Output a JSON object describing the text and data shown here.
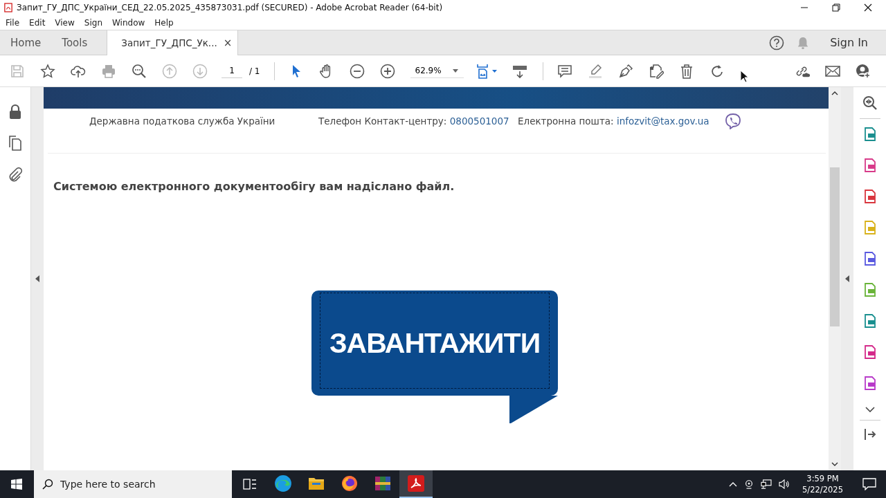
{
  "window": {
    "title": "Запит_ГУ_ДПС_України_СЕД_22.05.2025_435873031.pdf (SECURED) - Adobe Acrobat Reader (64-bit)"
  },
  "menu": [
    "File",
    "Edit",
    "View",
    "Sign",
    "Window",
    "Help"
  ],
  "tabs": [
    {
      "label": "Home",
      "selected": false
    },
    {
      "label": "Tools",
      "selected": false
    },
    {
      "label": "Запит_ГУ_ДПС_Ук...",
      "selected": true
    }
  ],
  "close_tab_glyph": "×",
  "sign_in": "Sign In",
  "toolbar": {
    "page": "1",
    "page_total": "/ 1",
    "zoom": "62.9%"
  },
  "document": {
    "org": "Державна податкова служба України",
    "phone_label": "Телефон Контакт-центру:",
    "phone": "0800501007",
    "email_label": "Електронна пошта:",
    "email": "infozvit@tax.gov.ua",
    "message": "Системою електронного документообігу вам надіслано файл.",
    "download_button": "ЗАВАНТАЖИТИ"
  },
  "taskbar": {
    "search_placeholder": "Type here to search",
    "time": "3:59 PM",
    "date": "5/22/2025",
    "apps": [
      {
        "kind": "edge",
        "selected": false
      },
      {
        "kind": "explorer",
        "selected": false
      },
      {
        "kind": "firefox",
        "selected": false
      },
      {
        "kind": "winrar",
        "selected": false
      },
      {
        "kind": "acrobat",
        "selected": true
      }
    ]
  }
}
